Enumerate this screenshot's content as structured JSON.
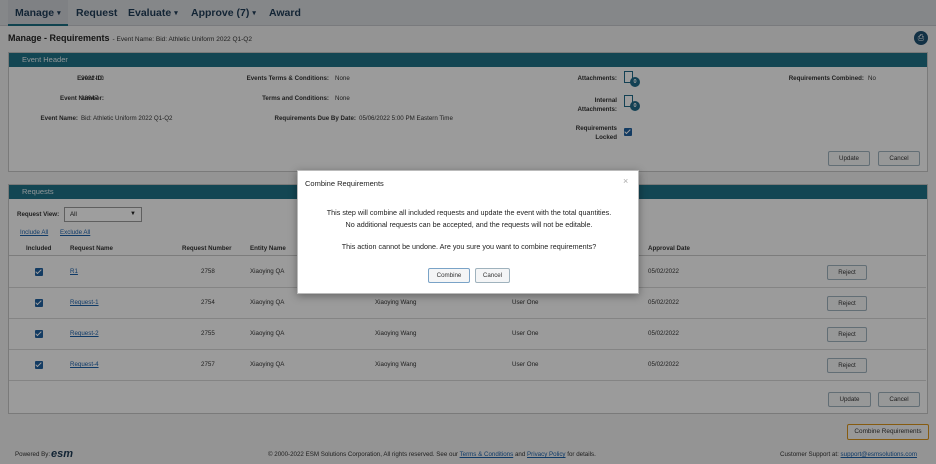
{
  "nav": {
    "items": [
      {
        "label": "Manage",
        "caret": "▾"
      },
      {
        "label": "Request",
        "caret": ""
      },
      {
        "label": "Evaluate",
        "caret": "▾"
      },
      {
        "label": "Approve (7)",
        "caret": "▾"
      },
      {
        "label": "Award",
        "caret": ""
      }
    ]
  },
  "page": {
    "title": "Manage - Requirements",
    "subtitle": "- Event Name: Bid: Athletic Uniform 2022 Q1-Q2"
  },
  "event_header": {
    "title": "Event Header",
    "event_id_label": "Event ID:",
    "event_id": "2022-10",
    "event_number_label": "Event Number:",
    "event_number": "28047",
    "event_name_label": "Event Name:",
    "event_name": "Bid: Athletic Uniform 2022 Q1-Q2",
    "terms_events_label": "Events Terms & Conditions:",
    "terms_events": "None",
    "terms_label": "Terms and Conditions:",
    "terms": "None",
    "due_label": "Requirements Due By Date:",
    "due": "05/06/2022 5:00 PM Eastern Time",
    "attachments_label": "Attachments:",
    "attachments_count": "0",
    "internal_label_1": "Internal",
    "internal_label_2": "Attachments:",
    "internal_count": "0",
    "locked_label_1": "Requirements",
    "locked_label_2": "Locked",
    "combined_label": "Requirements Combined:",
    "combined": "No",
    "update_label": "Update",
    "cancel_label": "Cancel"
  },
  "requests": {
    "title": "Requests",
    "view_label": "Request View:",
    "view_value": "All",
    "include_all": "Include All",
    "exclude_all": "Exclude All",
    "columns": {
      "included": "Included",
      "name": "Request Name",
      "number": "Request Number",
      "entity": "Entity Name",
      "approval": "Approval Date"
    },
    "rows": [
      {
        "name": "R1",
        "number": "2758",
        "entity": "Xiaoying QA",
        "requester": "",
        "approver": "",
        "date": "05/02/2022",
        "action": "Reject"
      },
      {
        "name": "Request-1",
        "number": "2754",
        "entity": "Xiaoying QA",
        "requester": "Xiaoying Wang",
        "approver": "User One",
        "date": "05/02/2022",
        "action": "Reject"
      },
      {
        "name": "Request-2",
        "number": "2755",
        "entity": "Xiaoying QA",
        "requester": "Xiaoying Wang",
        "approver": "User One",
        "date": "05/02/2022",
        "action": "Reject"
      },
      {
        "name": "Request-4",
        "number": "2757",
        "entity": "Xiaoying QA",
        "requester": "Xiaoying Wang",
        "approver": "User One",
        "date": "05/02/2022",
        "action": "Reject"
      }
    ],
    "update_label": "Update",
    "cancel_label": "Cancel"
  },
  "combine_button": "Combine Requirements",
  "footer": {
    "powered_by": "Powered By:",
    "logo": "esm",
    "copyright_prefix": "© 2000-2022 ESM Solutions Corporation, All rights reserved. See our",
    "terms_link": "Terms & Conditions",
    "and": "and",
    "privacy_link": "Privacy Policy",
    "copyright_suffix": "for details.",
    "support_prefix": "Customer Support at:",
    "support_email": "support@esmsolutions.com"
  },
  "modal": {
    "title": "Combine Requirements",
    "close": "×",
    "line1": "This step will combine all included requests and update the event with the total quantities.",
    "line2": "No additional requests can be accepted, and the requests will not be editable.",
    "line3": "This action cannot be undone. Are you sure you want to combine requirements?",
    "confirm_label": "Combine",
    "cancel_label": "Cancel"
  },
  "colors": {
    "accent": "#1f7186",
    "nav_text": "#1e3a55",
    "highlight": "#d9931a"
  }
}
